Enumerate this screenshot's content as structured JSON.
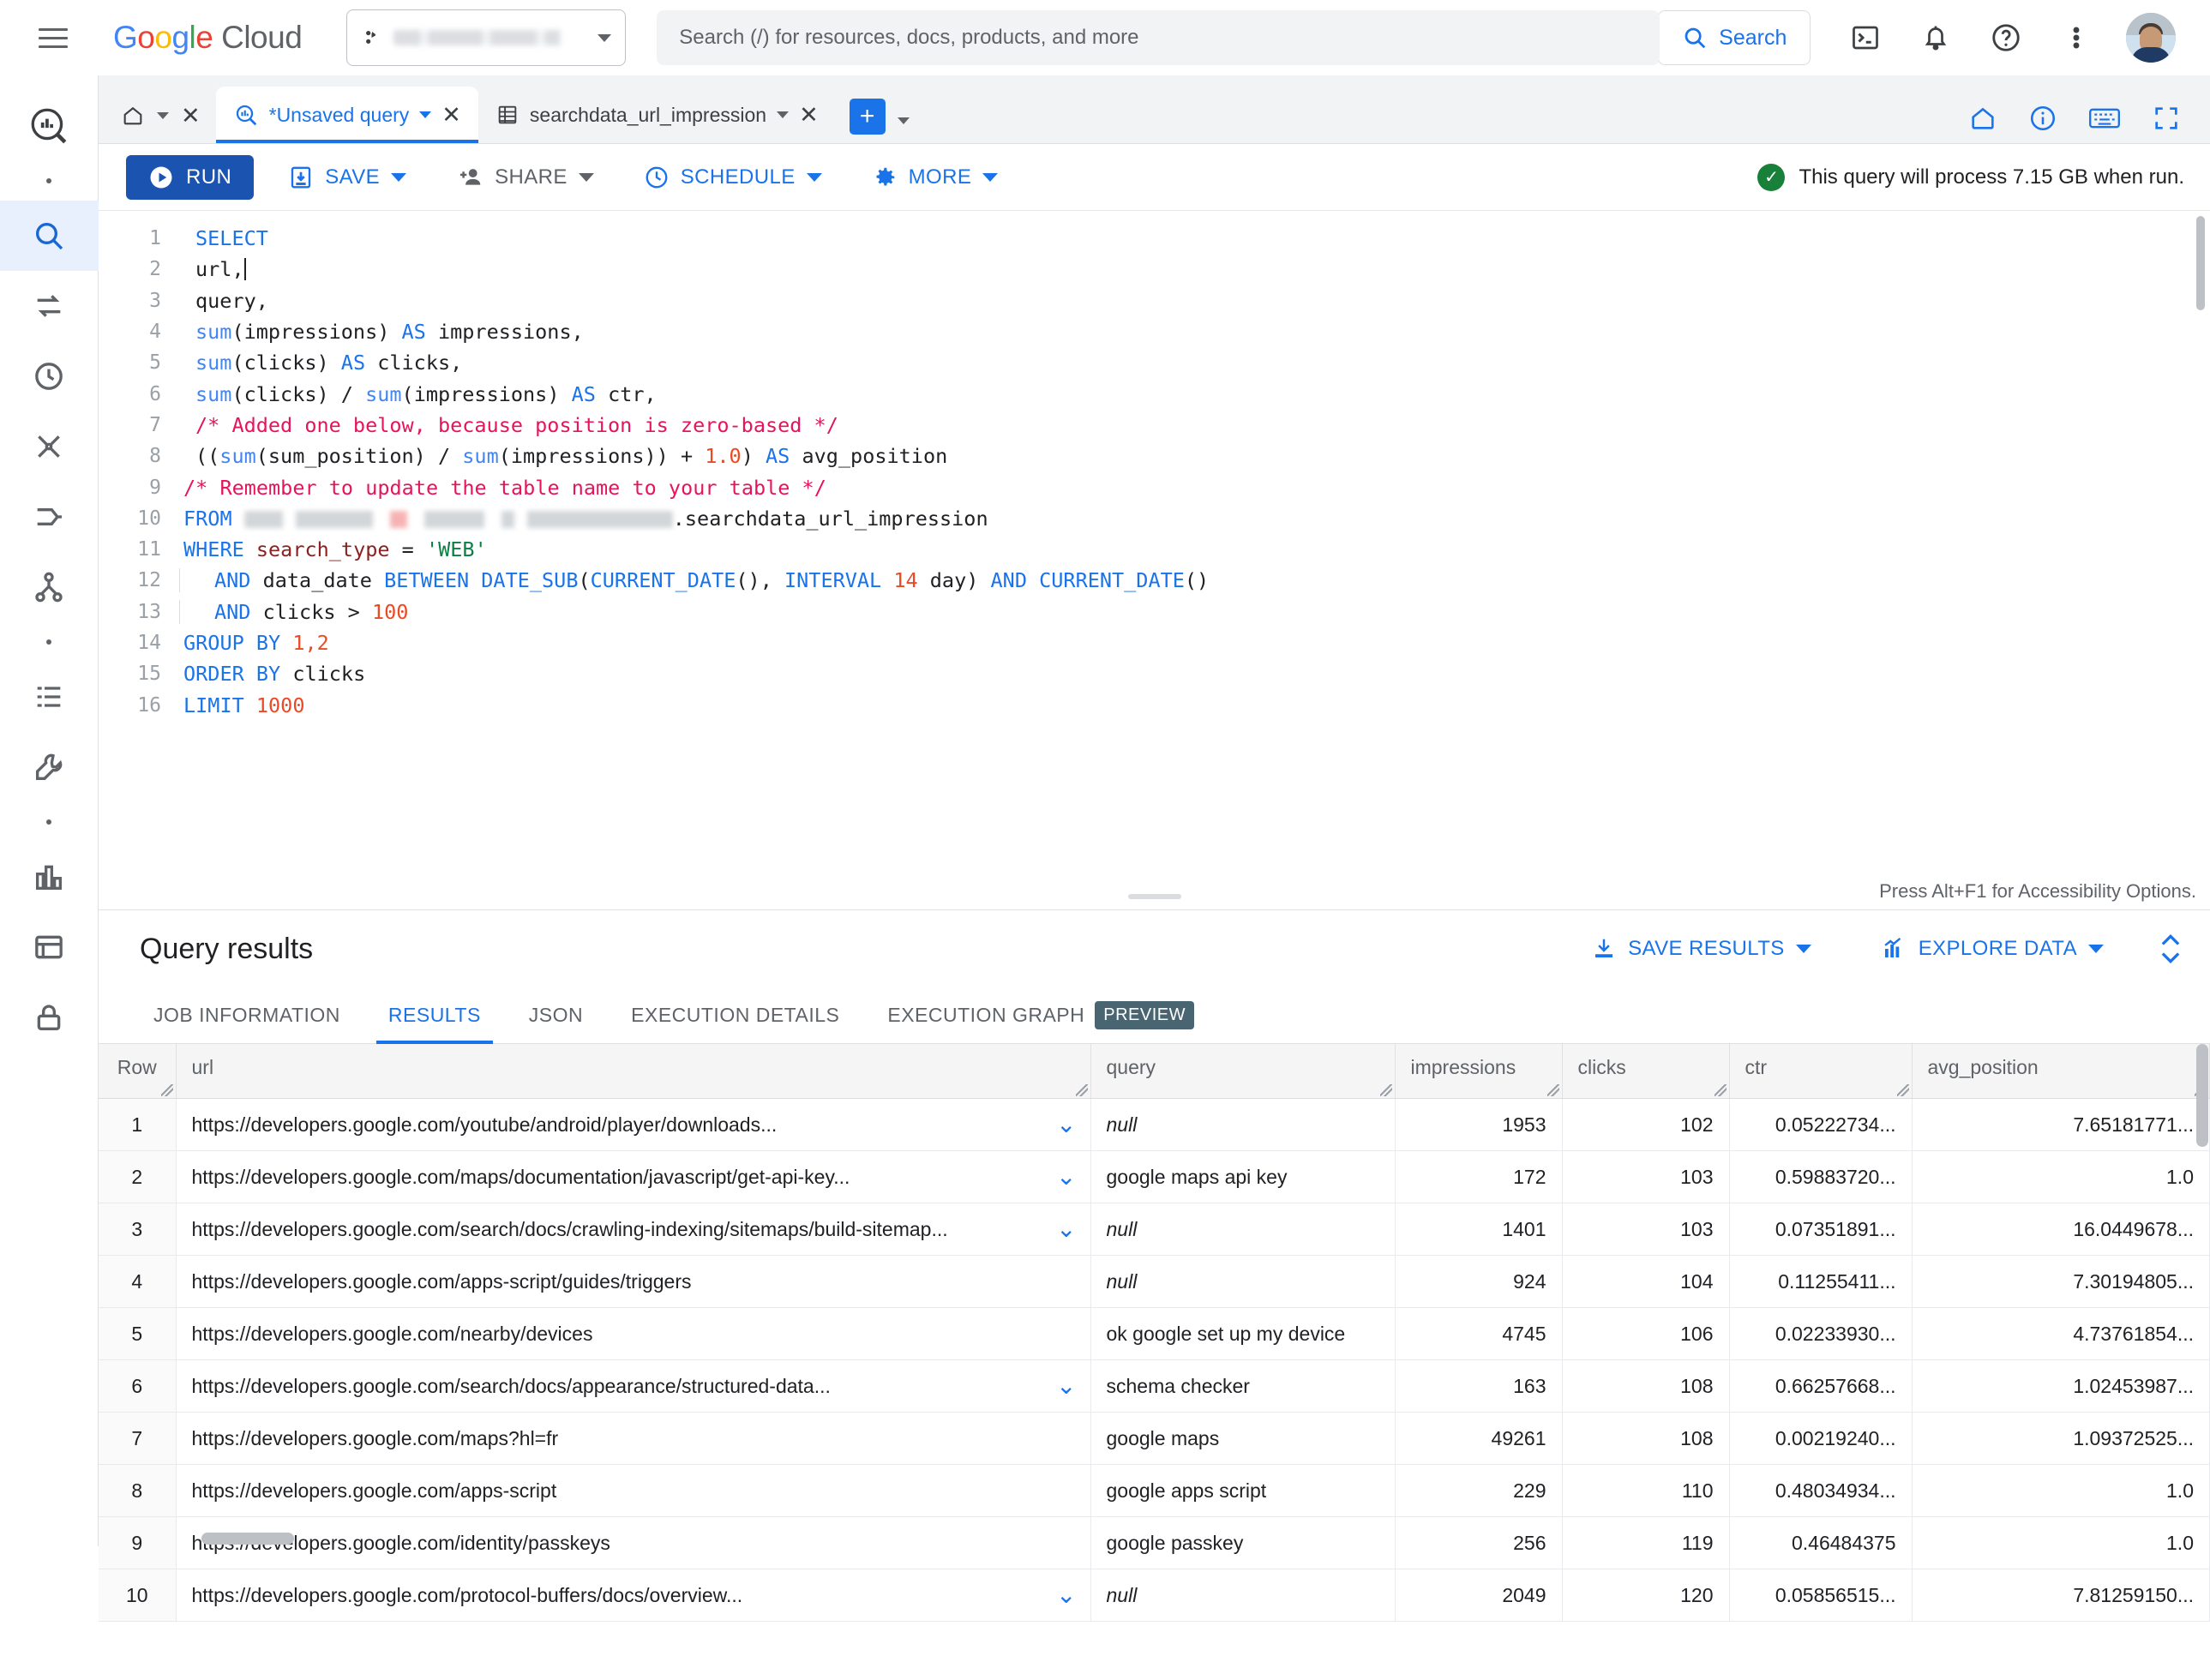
{
  "appbar": {
    "menu_icon": "hamburger-menu-icon",
    "logo_google": "Google",
    "logo_cloud": "Cloud",
    "project_selector": {
      "value": "",
      "redacted": true,
      "icon": "project-icon"
    },
    "search": {
      "placeholder": "Search (/) for resources, docs, products, and more",
      "value": "",
      "button_label": "Search"
    },
    "icons": [
      "cloud-shell-icon",
      "notifications-bell-icon",
      "help-question-icon",
      "more-vert-icon",
      "user-avatar"
    ]
  },
  "rail": {
    "items": [
      {
        "name": "bigquery-logo-icon",
        "active": false
      },
      {
        "name": "dot-separator",
        "active": false
      },
      {
        "name": "search-icon",
        "active": true
      },
      {
        "name": "transfers-icon",
        "active": false
      },
      {
        "name": "scheduled-queries-icon",
        "active": false
      },
      {
        "name": "analytics-hub-icon",
        "active": false
      },
      {
        "name": "dataform-icon",
        "active": false
      },
      {
        "name": "data-lineage-icon",
        "active": false
      },
      {
        "name": "dot-separator-2",
        "active": false
      },
      {
        "name": "job-history-icon",
        "active": false
      },
      {
        "name": "settings-wrench-icon",
        "active": false
      },
      {
        "name": "dot-separator-3",
        "active": false
      },
      {
        "name": "bi-engine-icon",
        "active": false
      },
      {
        "name": "capacity-icon",
        "active": false
      },
      {
        "name": "policy-lock-icon",
        "active": false
      }
    ]
  },
  "tabstrip": {
    "home_tab": {
      "icon": "home-icon"
    },
    "tabs": [
      {
        "label": "*Unsaved query",
        "icon": "query-icon",
        "active": true,
        "closable": true
      },
      {
        "label": "searchdata_url_impression",
        "icon": "table-icon",
        "active": false,
        "closable": true
      }
    ],
    "add_tab_label": "+",
    "right_icons": [
      "home-outline-icon",
      "info-icon",
      "keyboard-shortcuts-icon",
      "expand-panel-icon"
    ]
  },
  "toolbar": {
    "run_label": "RUN",
    "save_label": "SAVE",
    "share_label": "SHARE",
    "schedule_label": "SCHEDULE",
    "more_label": "MORE",
    "cost_message": "This query will process 7.15 GB when run."
  },
  "editor": {
    "accessibility_hint": "Press Alt+F1 for Accessibility Options.",
    "lines": [
      {
        "n": "1",
        "indent": false,
        "tokens": [
          {
            "t": "SELECT",
            "c": "kw"
          }
        ]
      },
      {
        "n": "2",
        "indent": false,
        "tokens": [
          {
            "t": "url,",
            "c": "plain"
          }
        ],
        "caret": true
      },
      {
        "n": "3",
        "indent": false,
        "tokens": [
          {
            "t": "query,",
            "c": "plain"
          }
        ]
      },
      {
        "n": "4",
        "indent": false,
        "tokens": [
          {
            "t": "sum",
            "c": "fn"
          },
          {
            "t": "(impressions) ",
            "c": "plain"
          },
          {
            "t": "AS",
            "c": "kw"
          },
          {
            "t": " impressions,",
            "c": "plain"
          }
        ]
      },
      {
        "n": "5",
        "indent": false,
        "tokens": [
          {
            "t": "sum",
            "c": "fn"
          },
          {
            "t": "(clicks) ",
            "c": "plain"
          },
          {
            "t": "AS",
            "c": "kw"
          },
          {
            "t": " clicks,",
            "c": "plain"
          }
        ]
      },
      {
        "n": "6",
        "indent": false,
        "tokens": [
          {
            "t": "sum",
            "c": "fn"
          },
          {
            "t": "(clicks) / ",
            "c": "plain"
          },
          {
            "t": "sum",
            "c": "fn"
          },
          {
            "t": "(impressions) ",
            "c": "plain"
          },
          {
            "t": "AS",
            "c": "kw"
          },
          {
            "t": " ctr,",
            "c": "plain"
          }
        ]
      },
      {
        "n": "7",
        "indent": false,
        "tokens": [
          {
            "t": "/* Added one below, because position is zero-based */",
            "c": "cmt"
          }
        ]
      },
      {
        "n": "8",
        "indent": false,
        "tokens": [
          {
            "t": "((",
            "c": "plain"
          },
          {
            "t": "sum",
            "c": "fn"
          },
          {
            "t": "(sum_position) / ",
            "c": "plain"
          },
          {
            "t": "sum",
            "c": "fn"
          },
          {
            "t": "(impressions)) + ",
            "c": "plain"
          },
          {
            "t": "1.0",
            "c": "num"
          },
          {
            "t": ") ",
            "c": "plain"
          },
          {
            "t": "AS",
            "c": "kw"
          },
          {
            "t": " avg_position",
            "c": "plain"
          }
        ]
      },
      {
        "n": "9",
        "indent": false,
        "tokens": [
          {
            "t": "/* Remember to update the table name to your table */",
            "c": "cmt"
          }
        ],
        "noindentpad": true
      },
      {
        "n": "10",
        "indent": false,
        "tokens": [
          {
            "t": "FROM ",
            "c": "kw"
          },
          {
            "t": "",
            "c": "redact"
          },
          {
            "t": ".searchdata_url_impression",
            "c": "plain"
          }
        ],
        "noindentpad": true
      },
      {
        "n": "11",
        "indent": false,
        "tokens": [
          {
            "t": "WHERE ",
            "c": "kw"
          },
          {
            "t": "search_type",
            "c": "fld"
          },
          {
            "t": " = ",
            "c": "plain"
          },
          {
            "t": "'WEB'",
            "c": "str"
          }
        ],
        "noindentpad": true
      },
      {
        "n": "12",
        "indent": true,
        "tokens": [
          {
            "t": "AND",
            "c": "kw"
          },
          {
            "t": " data_date ",
            "c": "plain"
          },
          {
            "t": "BETWEEN DATE_SUB",
            "c": "kw"
          },
          {
            "t": "(",
            "c": "plain"
          },
          {
            "t": "CURRENT_DATE",
            "c": "kw"
          },
          {
            "t": "(), ",
            "c": "plain"
          },
          {
            "t": "INTERVAL ",
            "c": "kw"
          },
          {
            "t": "14",
            "c": "num"
          },
          {
            "t": " day) ",
            "c": "plain"
          },
          {
            "t": "AND CURRENT_DATE",
            "c": "kw"
          },
          {
            "t": "()",
            "c": "plain"
          }
        ]
      },
      {
        "n": "13",
        "indent": true,
        "tokens": [
          {
            "t": "AND",
            "c": "kw"
          },
          {
            "t": " clicks > ",
            "c": "plain"
          },
          {
            "t": "100",
            "c": "num"
          }
        ]
      },
      {
        "n": "14",
        "indent": false,
        "tokens": [
          {
            "t": "GROUP BY ",
            "c": "kw"
          },
          {
            "t": "1,2",
            "c": "num"
          }
        ],
        "noindentpad": true
      },
      {
        "n": "15",
        "indent": false,
        "tokens": [
          {
            "t": "ORDER BY ",
            "c": "kw"
          },
          {
            "t": "clicks",
            "c": "plain"
          }
        ],
        "noindentpad": true
      },
      {
        "n": "16",
        "indent": false,
        "tokens": [
          {
            "t": "LIMIT ",
            "c": "kw"
          },
          {
            "t": "1000",
            "c": "num"
          }
        ],
        "noindentpad": true
      }
    ]
  },
  "results": {
    "title": "Query results",
    "save_results_label": "SAVE RESULTS",
    "explore_data_label": "EXPLORE DATA",
    "tabs": [
      {
        "label": "JOB INFORMATION",
        "active": false
      },
      {
        "label": "RESULTS",
        "active": true
      },
      {
        "label": "JSON",
        "active": false
      },
      {
        "label": "EXECUTION DETAILS",
        "active": false
      },
      {
        "label": "EXECUTION GRAPH",
        "active": false,
        "badge": "PREVIEW"
      }
    ],
    "columns": [
      "Row",
      "url",
      "query",
      "impressions",
      "clicks",
      "ctr",
      "avg_position"
    ],
    "rows": [
      {
        "row": "1",
        "url": "https://developers.google.com/youtube/android/player/downloads...",
        "expandable": true,
        "query": "null",
        "query_null": true,
        "impressions": "1953",
        "clicks": "102",
        "ctr": "0.05222734...",
        "avg_position": "7.65181771..."
      },
      {
        "row": "2",
        "url": "https://developers.google.com/maps/documentation/javascript/get-api-key...",
        "expandable": true,
        "query": "google maps api key",
        "query_null": false,
        "impressions": "172",
        "clicks": "103",
        "ctr": "0.59883720...",
        "avg_position": "1.0"
      },
      {
        "row": "3",
        "url": "https://developers.google.com/search/docs/crawling-indexing/sitemaps/build-sitemap...",
        "expandable": true,
        "query": "null",
        "query_null": true,
        "impressions": "1401",
        "clicks": "103",
        "ctr": "0.07351891...",
        "avg_position": "16.0449678..."
      },
      {
        "row": "4",
        "url": "https://developers.google.com/apps-script/guides/triggers",
        "expandable": false,
        "query": "null",
        "query_null": true,
        "impressions": "924",
        "clicks": "104",
        "ctr": "0.11255411...",
        "avg_position": "7.30194805..."
      },
      {
        "row": "5",
        "url": "https://developers.google.com/nearby/devices",
        "expandable": false,
        "query": "ok google set up my device",
        "query_null": false,
        "impressions": "4745",
        "clicks": "106",
        "ctr": "0.02233930...",
        "avg_position": "4.73761854..."
      },
      {
        "row": "6",
        "url": "https://developers.google.com/search/docs/appearance/structured-data...",
        "expandable": true,
        "query": "schema checker",
        "query_null": false,
        "impressions": "163",
        "clicks": "108",
        "ctr": "0.66257668...",
        "avg_position": "1.02453987..."
      },
      {
        "row": "7",
        "url": "https://developers.google.com/maps?hl=fr",
        "expandable": false,
        "query": "google maps",
        "query_null": false,
        "impressions": "49261",
        "clicks": "108",
        "ctr": "0.00219240...",
        "avg_position": "1.09372525..."
      },
      {
        "row": "8",
        "url": "https://developers.google.com/apps-script",
        "expandable": false,
        "query": "google apps script",
        "query_null": false,
        "impressions": "229",
        "clicks": "110",
        "ctr": "0.48034934...",
        "avg_position": "1.0"
      },
      {
        "row": "9",
        "url": "https://developers.google.com/identity/passkeys",
        "expandable": false,
        "query": "google passkey",
        "query_null": false,
        "impressions": "256",
        "clicks": "119",
        "ctr": "0.46484375",
        "avg_position": "1.0"
      },
      {
        "row": "10",
        "url": "https://developers.google.com/protocol-buffers/docs/overview...",
        "expandable": true,
        "query": "null",
        "query_null": true,
        "impressions": "2049",
        "clicks": "120",
        "ctr": "0.05856515...",
        "avg_position": "7.81259150..."
      }
    ]
  },
  "colors": {
    "accent_blue": "#1a73e8",
    "run_blue": "#1a53b0",
    "success_green": "#188038",
    "comment_pink": "#e5145c",
    "number_orange": "#ea4a25",
    "string_green": "#0b8043"
  }
}
